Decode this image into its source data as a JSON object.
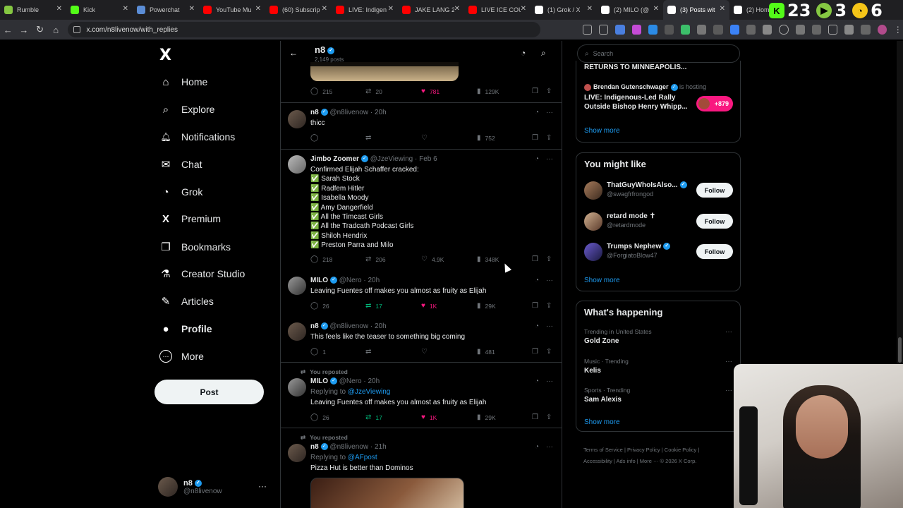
{
  "browser": {
    "tabs": [
      {
        "label": "Rumble",
        "color": "#85c742"
      },
      {
        "label": "Kick",
        "color": "#53fc18"
      },
      {
        "label": "Powerchat",
        "color": "#5b8dd6"
      },
      {
        "label": "YouTube Mu",
        "color": "#ff0000"
      },
      {
        "label": "(60) Subscrip",
        "color": "#ff0000"
      },
      {
        "label": "LIVE: Indigen",
        "color": "#ff0000"
      },
      {
        "label": "JAKE LANG 2",
        "color": "#ff0000"
      },
      {
        "label": "LIVE ICE COU",
        "color": "#ff0000"
      },
      {
        "label": "(1) Grok / X",
        "color": "#ffffff"
      },
      {
        "label": "(2) MILO (@",
        "color": "#ffffff"
      },
      {
        "label": "(3) Posts wit",
        "color": "#ffffff"
      },
      {
        "label": "(2) Hom",
        "color": "#ffffff"
      }
    ],
    "url": "x.com/n8livenow/with_replies"
  },
  "overlay": {
    "badge1": "K",
    "count1": "23",
    "badge2": "▶",
    "count2": "3",
    "badge3": "◔",
    "count3": "6"
  },
  "sidebar": {
    "logo": "X",
    "nav": [
      {
        "label": "Home",
        "icon": "⌂"
      },
      {
        "label": "Explore",
        "icon": "⌕"
      },
      {
        "label": "Notifications",
        "icon": "🔔︎"
      },
      {
        "label": "Chat",
        "icon": "✉"
      },
      {
        "label": "Grok",
        "icon": "◔"
      },
      {
        "label": "Premium",
        "icon": "X"
      },
      {
        "label": "Bookmarks",
        "icon": "❒"
      },
      {
        "label": "Creator Studio",
        "icon": "⚗"
      },
      {
        "label": "Articles",
        "icon": "✎"
      },
      {
        "label": "Profile",
        "icon": "●"
      },
      {
        "label": "More",
        "icon": "⋯"
      }
    ],
    "post_label": "Post",
    "account": {
      "name": "n8",
      "handle": "@n8livenow"
    }
  },
  "header": {
    "title": "n8",
    "subtitle": "2,149 posts"
  },
  "tweets": [
    {
      "name": "",
      "handle": "",
      "time": "",
      "text": [],
      "actions": {
        "reply": "215",
        "repost": "20",
        "like": "781",
        "views": "129K"
      }
    },
    {
      "name": "n8",
      "handle": "@n8livenow · 20h",
      "text": [
        "thicc"
      ],
      "actions": {
        "reply": "",
        "repost": "",
        "like": "",
        "views": "752"
      }
    },
    {
      "name": "Jimbo Zoomer",
      "handle": "@JzeViewing · Feb 6",
      "text": [
        "Confirmed Elijah Schaffer cracked:",
        "✅ Sarah Stock",
        "✅ Radfem Hitler",
        "✅ Isabella Moody",
        "✅ Amy Dangerfield",
        "✅ All the Timcast Girls",
        "✅ All the Tradcath Podcast Girls",
        "✅ Shiloh Hendrix",
        "✅ Preston Parra and Milo"
      ],
      "actions": {
        "reply": "218",
        "repost": "206",
        "like": "4.9K",
        "views": "348K"
      }
    },
    {
      "name": "MILO",
      "handle": "@Nero · 20h",
      "text": [
        "Leaving Fuentes off makes you almost as fruity as Elijah"
      ],
      "actions": {
        "reply": "26",
        "repost": "17",
        "like": "1K",
        "views": "29K"
      }
    },
    {
      "name": "n8",
      "handle": "@n8livenow · 20h",
      "text": [
        "This feels like the teaser to something big coming"
      ],
      "actions": {
        "reply": "1",
        "repost": "",
        "like": "",
        "views": "481"
      }
    },
    {
      "reposted": "You reposted",
      "name": "MILO",
      "handle": "@Nero · 20h",
      "replying_prefix": "Replying to ",
      "replying_to": "@JzeViewing",
      "text": [
        "Leaving Fuentes off makes you almost as fruity as Elijah"
      ],
      "actions": {
        "reply": "26",
        "repost": "17",
        "like": "1K",
        "views": "29K"
      }
    },
    {
      "reposted": "You reposted",
      "name": "n8",
      "handle": "@n8livenow · 21h",
      "replying_prefix": "Replying to ",
      "replying_to": "@AFpost",
      "text": [
        "Pizza Hut is better than Dominos"
      ]
    }
  ],
  "right": {
    "search_placeholder": "Search",
    "live": {
      "top_line": "RETURNS TO MINNEAPOLIS...",
      "host": "Brendan Gutenschwager",
      "host_suffix": "is hosting",
      "title": "LIVE: Indigenous-Led Rally Outside Bishop Henry Whipp...",
      "count": "+879",
      "show_more": "Show more"
    },
    "suggestions": {
      "title": "You might like",
      "items": [
        {
          "name": "ThatGuyWhoIsAlso...",
          "handle": "@swagfrfrongod",
          "follow": "Follow"
        },
        {
          "name": "retard mode ✝",
          "handle": "@retardmode",
          "follow": "Follow"
        },
        {
          "name": "Trumps Nephew",
          "handle": "@ForgiatoBlow47",
          "follow": "Follow"
        }
      ],
      "show_more": "Show more"
    },
    "happening": {
      "title": "What's happening",
      "items": [
        {
          "context": "Trending in United States",
          "topic": "Gold Zone"
        },
        {
          "context": "Music · Trending",
          "topic": "Kelis"
        },
        {
          "context": "Sports · Trending",
          "topic": "Sam Alexis"
        }
      ],
      "show_more": "Show more"
    },
    "footer": {
      "links": [
        "Terms of Service",
        "Privacy Policy",
        "Cookie Policy",
        "Accessibility",
        "Ads info",
        "More ···",
        "© 2026 X Corp."
      ]
    }
  }
}
